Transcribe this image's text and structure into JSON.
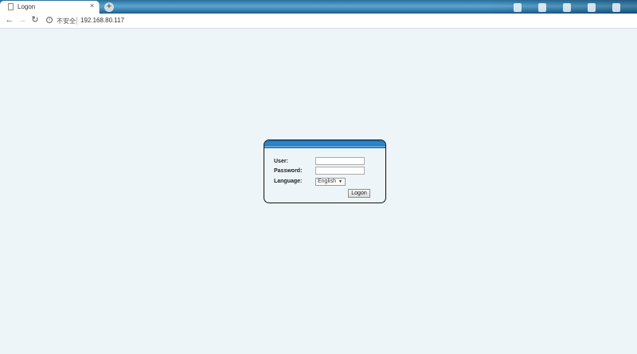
{
  "browser": {
    "tab_title": "Logon",
    "close_glyph": "×",
    "new_tab_glyph": "+",
    "security_text": "不安全",
    "address": "192.168.80.117",
    "icons": {
      "page": "page-icon",
      "back": "back-arrow-icon",
      "forward": "forward-arrow-icon",
      "reload": "reload-icon",
      "security": "info-icon"
    }
  },
  "login": {
    "user_label": "User:",
    "user_value": "",
    "password_label": "Password:",
    "password_value": "",
    "language_label": "Language:",
    "language_selected": "English",
    "button_label": "Logon"
  },
  "colors": {
    "page_background": "#eef5f8",
    "header_blue": "#1e75bb",
    "browser_blue": "#2a6f9a"
  }
}
